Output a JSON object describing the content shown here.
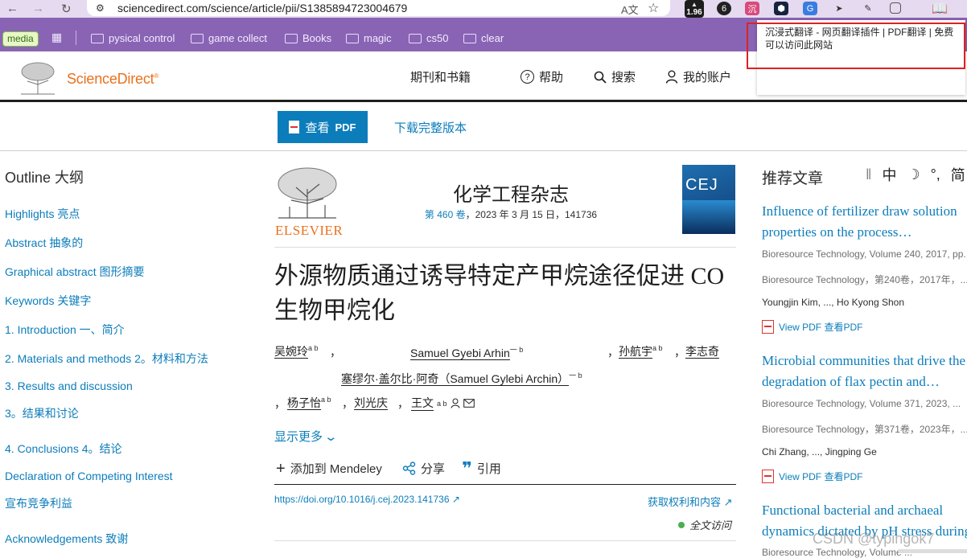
{
  "browser": {
    "url": "sciencedirect.com/science/article/pii/S1385894723004679",
    "ext_badge": "1.96",
    "bookmarks": [
      {
        "label": "media"
      },
      {
        "label": "pysical control"
      },
      {
        "label": "game collect"
      },
      {
        "label": "Books"
      },
      {
        "label": "magic"
      },
      {
        "label": "cs50"
      },
      {
        "label": "clear"
      }
    ],
    "tooltip": "沉浸式翻译 - 网页翻译插件 | PDF翻译 | 免费 可以访问此网站"
  },
  "header": {
    "brand": "ScienceDirect",
    "brand_mark": "®",
    "nav": [
      "期刊和书籍",
      "帮助",
      "搜索",
      "我的账户"
    ]
  },
  "pdfbar": {
    "view_pdf": "查看",
    "view_pdf_bold": "PDF",
    "download": "下载完整版本"
  },
  "outline": {
    "title": "Outline  大纲",
    "items": [
      "Highlights  亮点",
      "Abstract  抽象的",
      "Graphical abstract  图形摘要",
      "Keywords  关键字",
      "1. Introduction  一、简介",
      "2. Materials and methods  2。材料和方法",
      "3. Results and discussion",
      "3。结果和讨论",
      "4. Conclusions  4。结论",
      "Declaration of Competing Interest",
      "宣布竞争利益",
      "Acknowledgements  致谢"
    ]
  },
  "article": {
    "publisher": "ELSEVIER",
    "journal": "化学工程杂志",
    "volume_link": "第 460 卷",
    "volume_rest": "，2023 年 3 月 15 日，141736",
    "cover_text": "CEJ",
    "title": "外源物质通过诱导特定产甲烷途径促进 CO 生物甲烷化",
    "authors": {
      "a1": "吴婉玲",
      "a1_sup": "a b",
      "sep1": "，",
      "a2": "Samuel Gyebi Arhin",
      "a2_sup": "一 b",
      "sep2": "，",
      "a3": "孙航宇",
      "a3_sup": "a b",
      "sep3": "，",
      "a4": "李志奇",
      "a5": "塞缪尔·盖尔比·阿奇（Samuel Gylebi Archin）",
      "a5_sup": "一 b",
      "sep4": "，",
      "a6": "杨子怡",
      "a6_sup": "a b",
      "sep5": "，",
      "a7": "刘光庆",
      "sep6": "，",
      "a8": "王文",
      "a8_sup": "a b"
    },
    "show_more": "显示更多",
    "actions": [
      "添加到 Mendeley",
      "分享",
      "引用"
    ],
    "doi": "https://doi.org/10.1016/j.cej.2023.141736",
    "rights": "获取权利和内容",
    "access": "全文访问"
  },
  "recommended": {
    "title": "推荐文章",
    "translate_bar": [
      "‖",
      "中",
      "☽",
      "°,",
      "简"
    ],
    "items": [
      {
        "title_l1": "Influence of fertilizer draw solution",
        "title_l2": "properties on the process…",
        "source": "Bioresource Technology, Volume 240, 2017, pp. ...",
        "source_zh": "Bioresource Technology，第240卷，2017年，...",
        "authors": "Youngjin Kim, ..., Ho Kyong Shon",
        "pdf": "View PDF  查看PDF"
      },
      {
        "title_l1": "Microbial communities that drive the",
        "title_l2": "degradation of flax pectin and…",
        "source": "Bioresource Technology, Volume 371, 2023, ...",
        "source_zh": "Bioresource Technology，第371卷，2023年，...",
        "authors": "Chi Zhang, ..., Jingping Ge",
        "pdf": "View PDF  查看PDF"
      },
      {
        "title_l1": "Functional bacterial and archaeal",
        "title_l2": "dynamics dictated by pH stress during",
        "source": "Bioresource Technology, Volume ..."
      }
    ],
    "watermark": "CSDN @typingok7"
  }
}
